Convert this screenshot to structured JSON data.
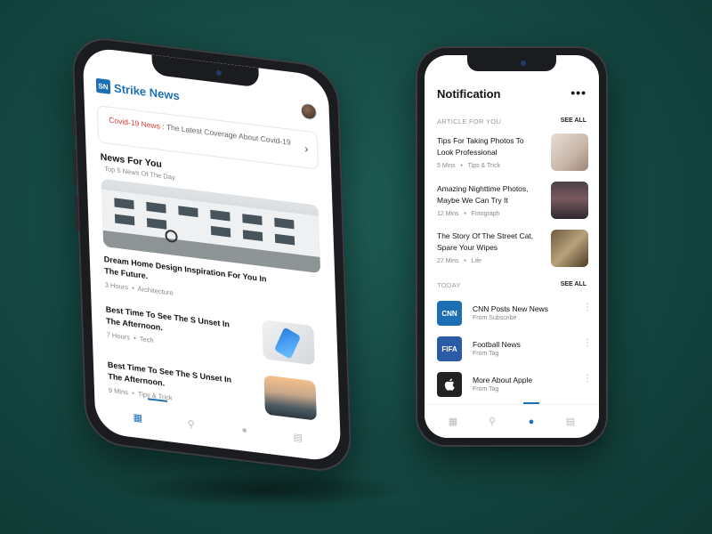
{
  "left_app": {
    "brand": {
      "logo_mark": "SN",
      "name": "Strike News"
    },
    "banner": {
      "highlight": "Covid-19 News :",
      "text": "The Latest Coverage About Covid-19"
    },
    "section": {
      "title": "News For You",
      "subtitle": "Top 5 News Of The Day"
    },
    "featured": {
      "title": "Dream Home Design Inspiration For You In The Future.",
      "time": "3 Hours",
      "category": "Architecture"
    },
    "list": [
      {
        "title": "Best Time To See The S Unset In The Afternoon.",
        "time": "7 Hours",
        "category": "Tech"
      },
      {
        "title": "Best Time To See The S Unset In The Afternoon.",
        "time": "9 Mins",
        "category": "Tips & Trick"
      }
    ],
    "tabs": [
      {
        "icon": "home-grid-icon",
        "active": true
      },
      {
        "icon": "search-icon",
        "active": false
      },
      {
        "icon": "notification-icon",
        "active": false
      },
      {
        "icon": "chart-icon",
        "active": false
      }
    ]
  },
  "right_app": {
    "title": "Notification",
    "articles_section": {
      "label": "ARTICLE FOR YOU",
      "see_all": "SEE ALL"
    },
    "articles": [
      {
        "title": "Tips For Taking Photos To Look Professional",
        "time": "5 Mins",
        "category": "Tips & Trick"
      },
      {
        "title": "Amazing Nighttime Photos, Maybe We Can Try It",
        "time": "12 Mins",
        "category": "Fotograph"
      },
      {
        "title": "The Story Of The Street Cat, Spare Your Wipes",
        "time": "27 Mins",
        "category": "Life"
      }
    ],
    "today_section": {
      "label": "TODAY",
      "see_all": "SEE ALL"
    },
    "notifications": [
      {
        "logo": "CNN",
        "color": "#1c6fb3",
        "title": "CNN Posts New News",
        "sub": "From Subscribe"
      },
      {
        "logo": "FIFA",
        "color": "#2b5aa6",
        "title": "Football News",
        "sub": "From Tag"
      },
      {
        "logo": "",
        "color": "#222222",
        "title": "More About Apple",
        "sub": "From Tag"
      }
    ],
    "tabs": [
      {
        "icon": "home-grid-icon",
        "active": false
      },
      {
        "icon": "search-icon",
        "active": false
      },
      {
        "icon": "notification-icon",
        "active": true
      },
      {
        "icon": "chart-icon",
        "active": false
      }
    ]
  },
  "colors": {
    "accent": "#1c6fb3",
    "alert": "#d23b3b",
    "background": "#164a44"
  }
}
